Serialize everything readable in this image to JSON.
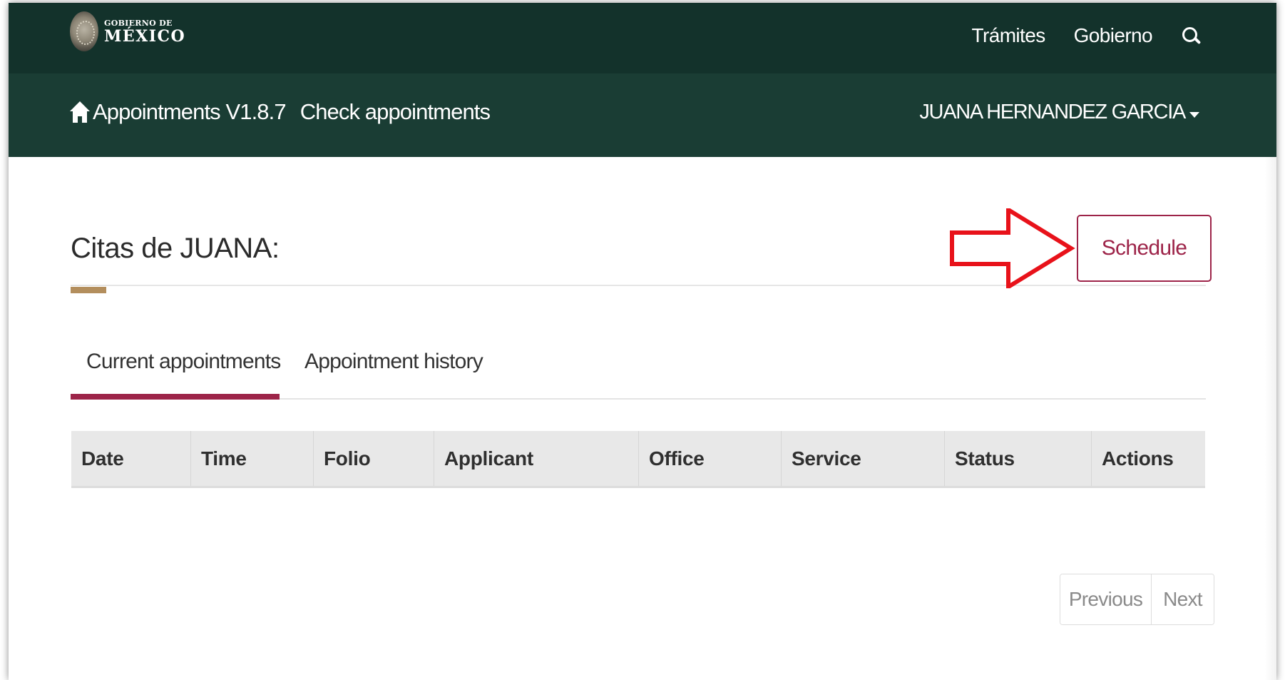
{
  "gov_header": {
    "logo_line1": "GOBIERNO DE",
    "logo_line2": "MÉXICO",
    "nav": [
      "Trámites",
      "Gobierno"
    ],
    "search_icon": "search-icon"
  },
  "app_header": {
    "home_icon": "home-icon",
    "app_title": "Appointments V1.8.7",
    "page_link": "Check appointments",
    "user_name": "JUANA HERNANDEZ GARCIA"
  },
  "main": {
    "heading": "Citas de JUANA:",
    "schedule_button": "Schedule",
    "tabs": [
      {
        "label": "Current appointments",
        "active": true
      },
      {
        "label": "Appointment history",
        "active": false
      }
    ],
    "table": {
      "columns": [
        "Date",
        "Time",
        "Folio",
        "Applicant",
        "Office",
        "Service",
        "Status",
        "Actions"
      ],
      "rows": []
    },
    "pagination": {
      "previous": "Previous",
      "next": "Next"
    }
  },
  "colors": {
    "gov_bar": "#13322b",
    "app_bar": "#1a3d34",
    "accent_wine": "#9d2449",
    "accent_gold": "#b38e5d",
    "annotation_red": "#e8121a"
  }
}
